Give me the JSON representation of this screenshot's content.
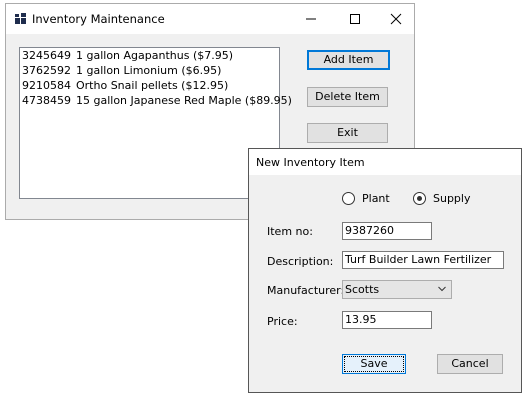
{
  "main_window": {
    "title": "Inventory Maintenance",
    "list_items": [
      {
        "item_no": "3245649",
        "description": "1 gallon Agapanthus ($7.95)"
      },
      {
        "item_no": "3762592",
        "description": "1 gallon Limonium ($6.95)"
      },
      {
        "item_no": "9210584",
        "description": "Ortho Snail pellets ($12.95)"
      },
      {
        "item_no": "4738459",
        "description": "15 gallon Japanese Red Maple ($89.95)"
      }
    ],
    "buttons": {
      "add": "Add Item",
      "delete": "Delete Item",
      "exit": "Exit"
    }
  },
  "dialog": {
    "title": "New Inventory Item",
    "radio_plant": "Plant",
    "radio_supply": "Supply",
    "selected_type": "Supply",
    "labels": {
      "item_no": "Item no:",
      "description": "Description:",
      "manufacturer": "Manufacturer:",
      "price": "Price:"
    },
    "values": {
      "item_no": "9387260",
      "description": "Turf Builder Lawn Fertilizer",
      "manufacturer": "Scotts",
      "price": "13.95"
    },
    "buttons": {
      "save": "Save",
      "cancel": "Cancel"
    }
  },
  "colors": {
    "focus_accent": "#0078d7",
    "window_bg": "#f0f0f0"
  },
  "icons": {
    "app": "app-grid-icon",
    "minimize": "minimize-icon",
    "maximize": "maximize-icon",
    "close": "close-icon",
    "dropdown": "chevron-down-icon"
  }
}
